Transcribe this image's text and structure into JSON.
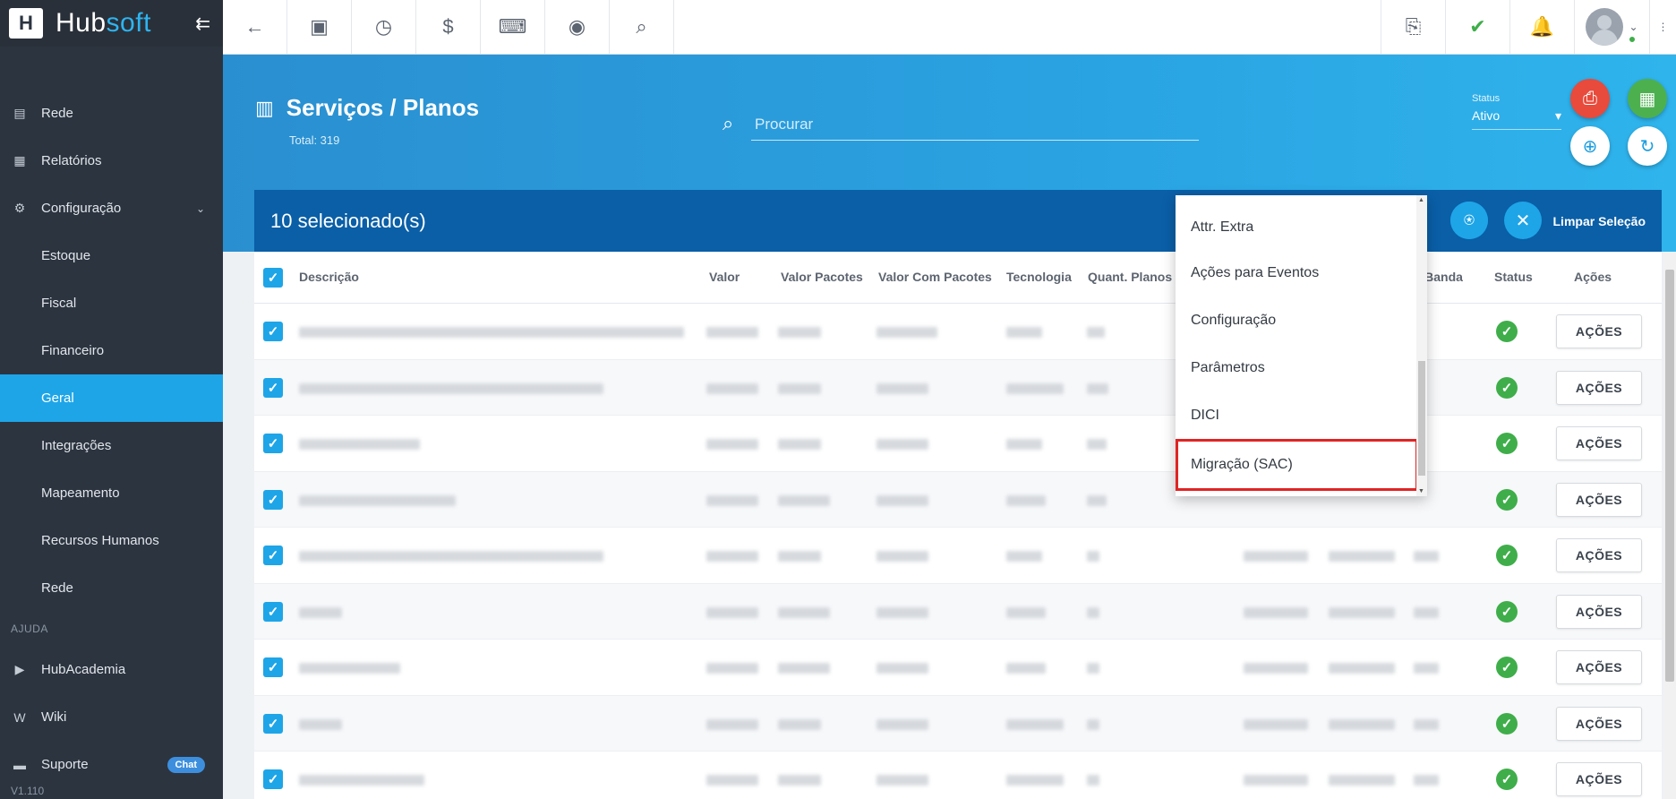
{
  "brand": {
    "logo_letter": "H",
    "name_part1": "Hub",
    "name_part2": "soft"
  },
  "sidebar": {
    "items": [
      {
        "label": "Rede",
        "icon": "server-icon",
        "glyph": "▤"
      },
      {
        "label": "Relatórios",
        "icon": "document-icon",
        "glyph": "▦"
      },
      {
        "label": "Configuração",
        "icon": "gear-icon",
        "glyph": "⚙"
      }
    ],
    "sub_items": [
      {
        "label": "Estoque"
      },
      {
        "label": "Fiscal"
      },
      {
        "label": "Financeiro"
      },
      {
        "label": "Geral",
        "active": true
      },
      {
        "label": "Integrações"
      },
      {
        "label": "Mapeamento"
      },
      {
        "label": "Recursos Humanos"
      },
      {
        "label": "Rede"
      }
    ],
    "section_help": "AJUDA",
    "help_items": [
      {
        "label": "HubAcademia",
        "icon": "youtube-icon",
        "glyph": "▶"
      },
      {
        "label": "Wiki",
        "icon": "wiki-icon",
        "glyph": "W"
      },
      {
        "label": "Suporte",
        "icon": "chat-icon",
        "glyph": "▬"
      }
    ],
    "chat_badge": "Chat",
    "version": "V1.110"
  },
  "page": {
    "title": "Serviços / Planos",
    "total": "Total: 319",
    "search_placeholder": "Procurar",
    "status_label": "Status",
    "status_value": "Ativo"
  },
  "selection": {
    "count_text": "10 selecionado(s)",
    "clear_label": "Limpar Seleção"
  },
  "table": {
    "columns": [
      "Descrição",
      "Valor",
      "Valor Pacotes",
      "Valor Com Pacotes",
      "Tecnologia",
      "Quant. Planos",
      "ar Banda",
      "Status",
      "Ações"
    ],
    "action_label": "AÇÕES",
    "row_count": 9
  },
  "dropdown": {
    "items": [
      "Attr. Extra",
      "Ações para Eventos",
      "Configuração",
      "Parâmetros",
      "DICI",
      "Migração (SAC)"
    ]
  },
  "colors": {
    "sidebar_bg": "#2c3440",
    "accent": "#1ea5e8",
    "selection_bar": "#0a5fa7",
    "status_ok": "#3fae4a",
    "pdf": "#e84a3c",
    "excel": "#4cb04f",
    "highlight_border": "#e02424"
  }
}
